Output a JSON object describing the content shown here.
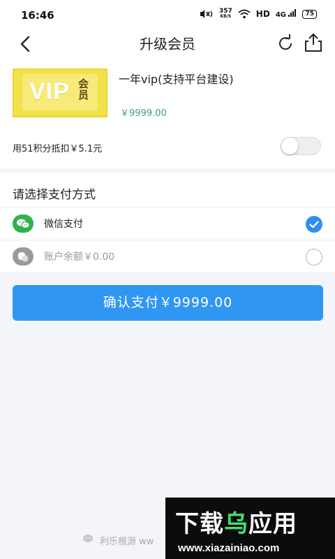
{
  "status_bar": {
    "time": "16:46",
    "net_speed_value": "357",
    "net_speed_unit": "KB/S",
    "hd": "HD",
    "signal": "4G",
    "battery": "75"
  },
  "header": {
    "title": "升级会员",
    "icons": [
      "back-arrow-icon",
      "refresh-icon",
      "share-icon"
    ]
  },
  "product": {
    "image_text": "VIP",
    "image_badge": "会员",
    "name": "一年vip(支持平台建设)",
    "price": "￥9999.00",
    "points_text": "用51积分抵扣￥5.1元",
    "points_toggle_on": false
  },
  "payment": {
    "title": "请选择支付方式",
    "options": [
      {
        "label": "微信支付",
        "icon": "wechat-icon",
        "selected": true
      },
      {
        "label": "账户余额￥0.00",
        "icon": "coins-icon",
        "selected": false
      }
    ]
  },
  "confirm_button": "确认支付￥9999.00",
  "footer": {
    "text": "利乐根源 ww"
  },
  "watermark": {
    "title_part1": "下载",
    "title_part2": "乌",
    "title_part3": "应用",
    "url": "www.xiazainiao.com"
  },
  "colors": {
    "accent": "#2f97f2",
    "price": "#3fa36b",
    "wechat": "#2fb24c",
    "background": "#f4f5fa"
  }
}
